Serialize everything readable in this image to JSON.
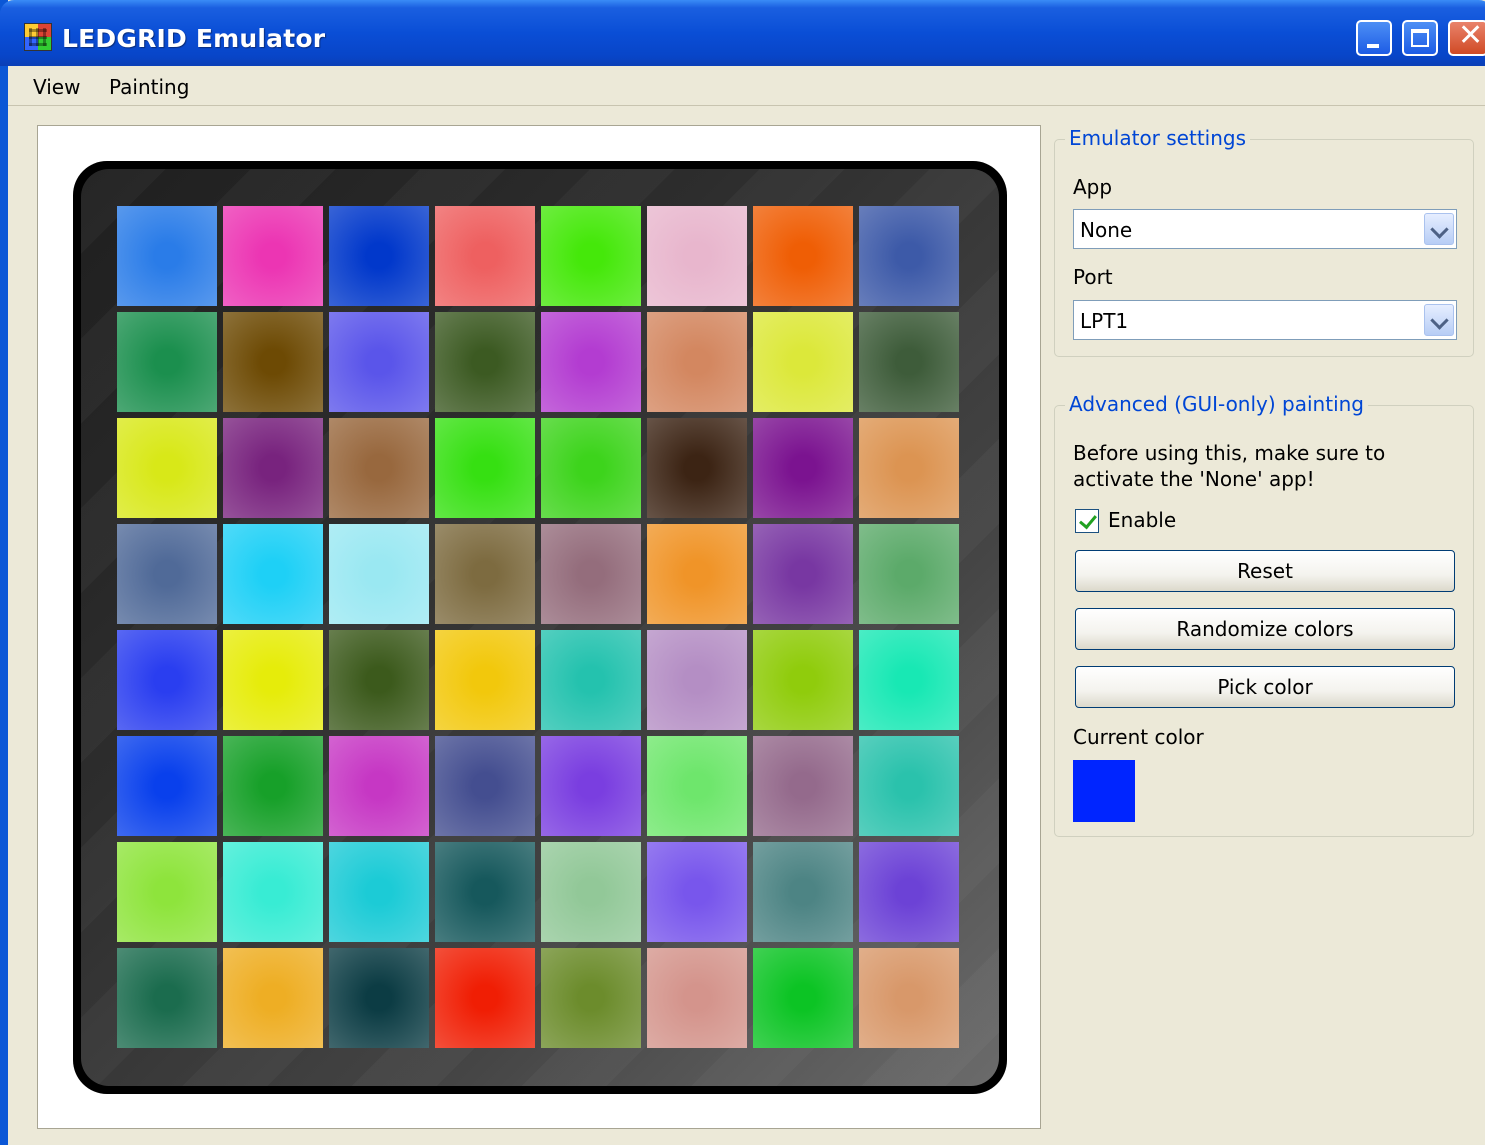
{
  "window": {
    "title": "LEDGRID Emulator"
  },
  "menu": {
    "items": [
      "View",
      "Painting"
    ]
  },
  "emulator_settings": {
    "title": "Emulator settings",
    "app_label": "App",
    "app_value": "None",
    "port_label": "Port",
    "port_value": "LPT1"
  },
  "painting": {
    "title": "Advanced (GUI-only) painting",
    "note": "Before using this, make sure to activate the 'None' app!",
    "enable_label": "Enable",
    "enable_checked": true,
    "reset_label": "Reset",
    "randomize_label": "Randomize colors",
    "pick_label": "Pick color",
    "current_color_label": "Current color",
    "current_color": "#0025ff"
  },
  "led_grid": {
    "rows": 8,
    "cols": 8,
    "colors": [
      [
        "#2a7ce8",
        "#ec35b3",
        "#0138cb",
        "#ee6060",
        "#45e80a",
        "#e8b6cd",
        "#ef5e05",
        "#3d5aa8"
      ],
      [
        "#1b8f4e",
        "#6d4a04",
        "#5a55ea",
        "#3c5a22",
        "#b33cd1",
        "#d38760",
        "#dce83a",
        "#3e5c3a"
      ],
      [
        "#d8e818",
        "#78237e",
        "#98683e",
        "#36e012",
        "#3dd41c",
        "#3c2414",
        "#7b1390",
        "#dc9452"
      ],
      [
        "#506a98",
        "#1ed0f6",
        "#9ae8f2",
        "#7d6b40",
        "#946d7c",
        "#f09428",
        "#7837a2",
        "#5caa6a"
      ],
      [
        "#2a3ef0",
        "#e6ec0a",
        "#3c5a1c",
        "#f2c80c",
        "#24c2ae",
        "#b48ec4",
        "#90cc0c",
        "#18e8b4"
      ],
      [
        "#0940ec",
        "#17a029",
        "#c637c4",
        "#444e90",
        "#7a3ee0",
        "#6ee66c",
        "#946a8c",
        "#2ac2ac"
      ],
      [
        "#8ee43c",
        "#38ecd4",
        "#1ccbd6",
        "#16585c",
        "#92c898",
        "#7856ec",
        "#4d8484",
        "#6c42d6"
      ],
      [
        "#1b6c4e",
        "#eeae24",
        "#0c3c44",
        "#f01e04",
        "#6c8c2c",
        "#d4948c",
        "#0cc424",
        "#d8986a"
      ]
    ]
  }
}
